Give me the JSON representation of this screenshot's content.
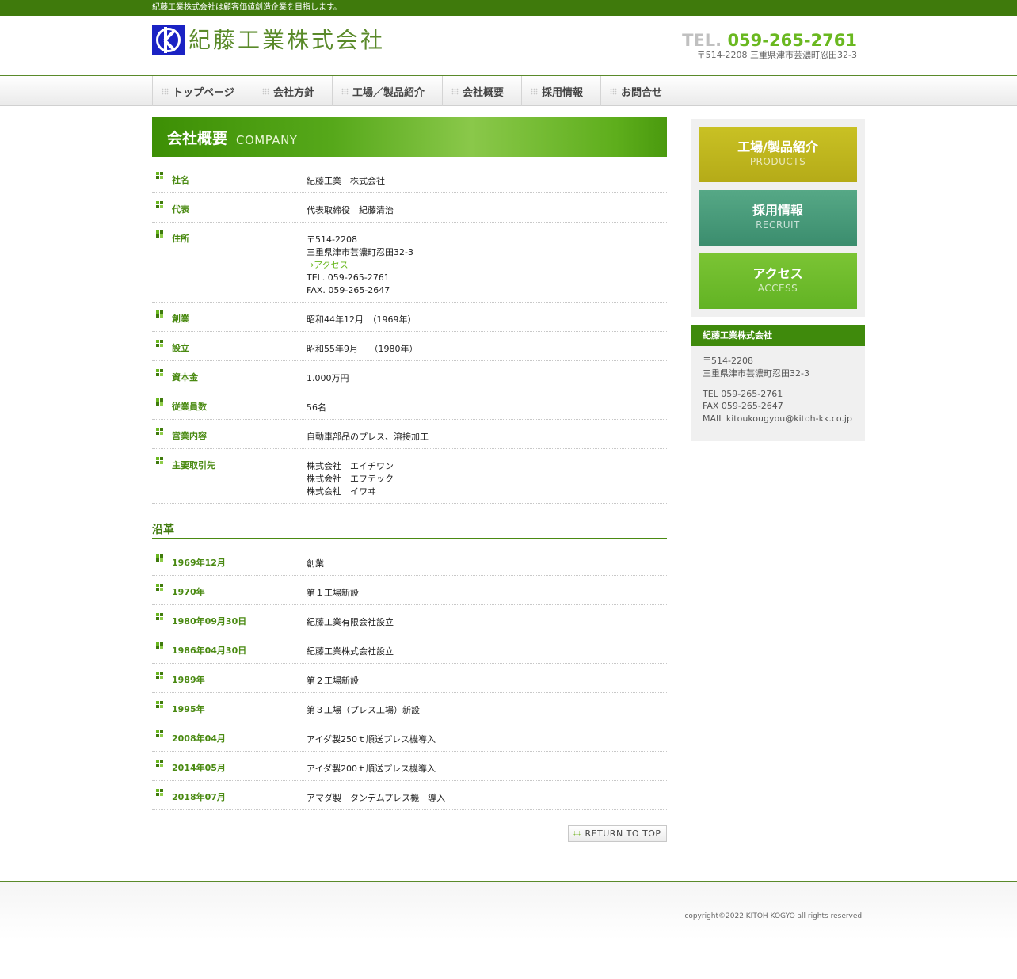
{
  "header": {
    "tagline": "紀藤工業株式会社は顧客価値創造企業を目指します。",
    "company_logo_text": "紀藤工業株式会社",
    "tel_label": "TEL.",
    "tel_number": "059-265-2761",
    "address": "〒514-2208 三重県津市芸濃町忍田32-3"
  },
  "nav": {
    "items": [
      {
        "label": "トップページ"
      },
      {
        "label": "会社方針"
      },
      {
        "label": "工場／製品紹介"
      },
      {
        "label": "会社概要"
      },
      {
        "label": "採用情報"
      },
      {
        "label": "お問合せ"
      }
    ]
  },
  "page": {
    "title_jp": "会社概要",
    "title_en": "COMPANY"
  },
  "company": {
    "rows": [
      {
        "label": "社名",
        "lines": [
          "紀藤工業　株式会社"
        ]
      },
      {
        "label": "代表",
        "lines": [
          "代表取締役　紀藤清治"
        ]
      },
      {
        "label": "住所",
        "lines": [
          "〒514-2208",
          "三重県津市芸濃町忍田32-3"
        ],
        "link": "→アクセス",
        "extra": [
          "TEL. 059-265-2761",
          "FAX. 059-265-2647"
        ]
      },
      {
        "label": "創業",
        "lines": [
          "昭和44年12月　（1969年）"
        ]
      },
      {
        "label": "設立",
        "lines": [
          "昭和55年9月　 （1980年）"
        ]
      },
      {
        "label": "資本金",
        "lines": [
          "1.000万円"
        ]
      },
      {
        "label": "従業員数",
        "lines": [
          "56名"
        ]
      },
      {
        "label": "営業内容",
        "lines": [
          "自動車部品のプレス、溶接加工"
        ]
      },
      {
        "label": "主要取引先",
        "lines": [
          "株式会社　エイチワン",
          "株式会社　エフテック",
          "株式会社　イワヰ"
        ]
      }
    ]
  },
  "history": {
    "title": "沿革",
    "rows": [
      {
        "date": "1969年12月",
        "event": "創業"
      },
      {
        "date": "1970年",
        "event": "第１工場新設"
      },
      {
        "date": "1980年09月30日",
        "event": "紀藤工業有限会社設立"
      },
      {
        "date": "1986年04月30日",
        "event": "紀藤工業株式会社設立"
      },
      {
        "date": "1989年",
        "event": "第２工場新設"
      },
      {
        "date": "1995年",
        "event": "第３工場（プレス工場）新設"
      },
      {
        "date": "2008年04月",
        "event": "アイダ製250ｔ順送プレス機導入"
      },
      {
        "date": "2014年05月",
        "event": "アイダ製200ｔ順送プレス機導入"
      },
      {
        "date": "2018年07月",
        "event": "アマダ製　タンデムプレス機　導入"
      }
    ]
  },
  "return_to_top": "RETURN TO TOP",
  "sidebar": {
    "banners": [
      {
        "jp": "工場/製品紹介",
        "en": "PRODUCTS"
      },
      {
        "jp": "採用情報",
        "en": "RECRUIT"
      },
      {
        "jp": "アクセス",
        "en": "ACCESS"
      }
    ],
    "info": {
      "title": "紀藤工業株式会社",
      "postal": "〒514-2208",
      "address": "三重県津市芸濃町忍田32-3",
      "tel": "TEL 059-265-2761",
      "fax": "FAX 059-265-2647",
      "mail": "MAIL kitoukougyou@kitoh-kk.co.jp"
    }
  },
  "footer": {
    "copyright": "copyright©2022 KITOH KOGYO all rights reserved."
  },
  "colors": {
    "brand_green": "#3f7a0c",
    "accent_green": "#6ab820",
    "logo_blue": "#1a22c4",
    "products_banner": "#c9c124",
    "recruit_banner": "#56a886",
    "access_banner": "#7bc434"
  }
}
